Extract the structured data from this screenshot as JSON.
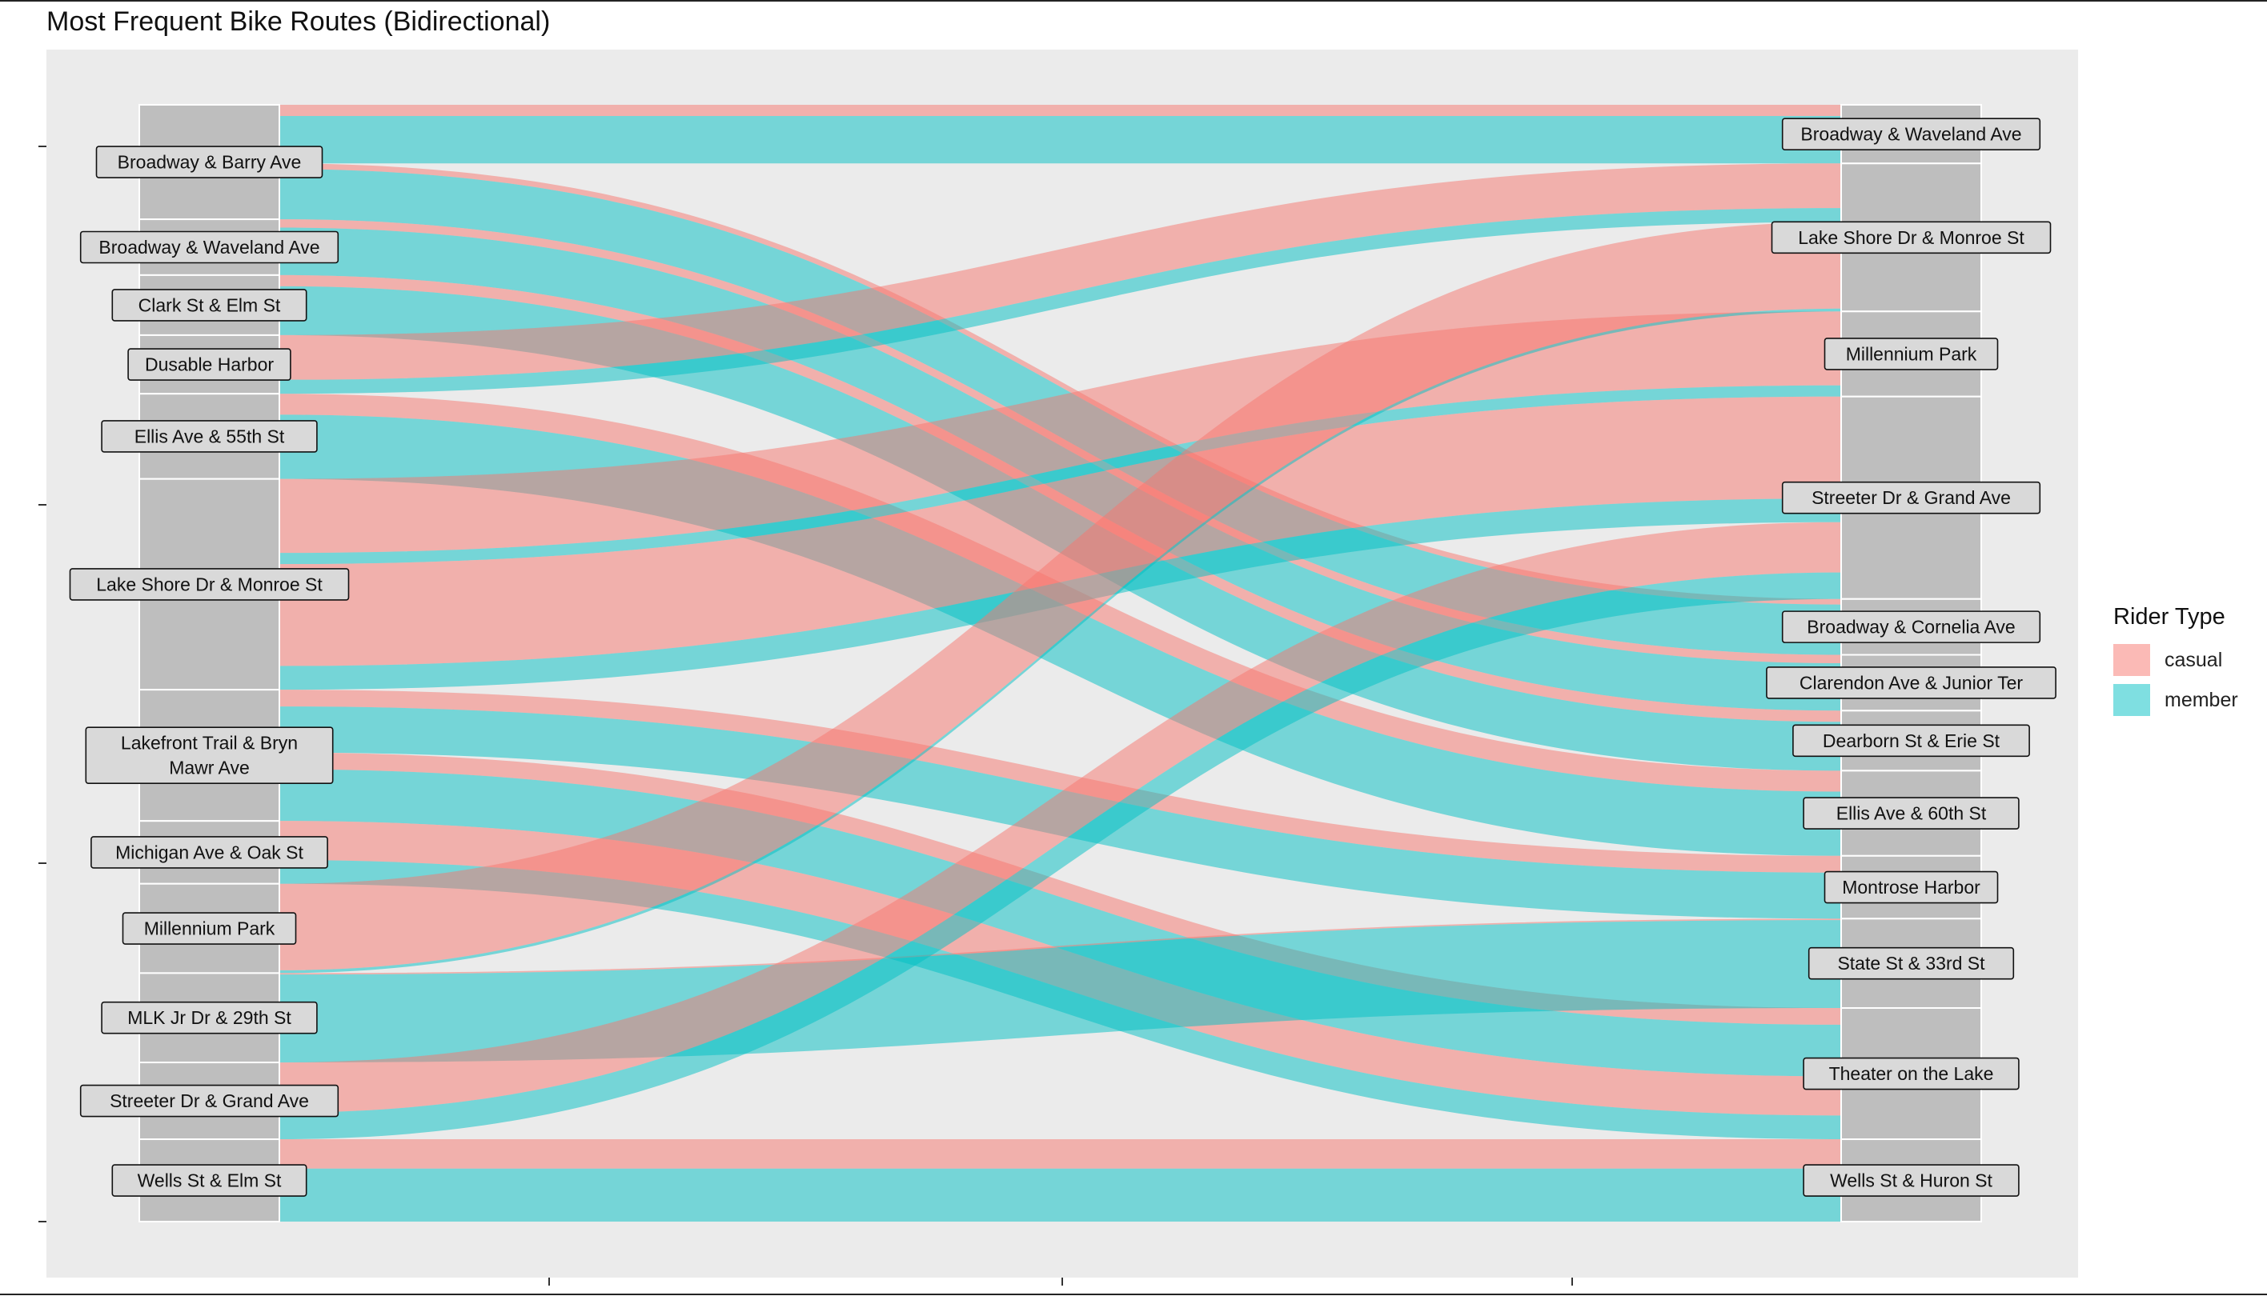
{
  "chart_data": {
    "type": "alluvial",
    "title": "Most Frequent Bike Routes (Bidirectional)",
    "legend_title": "Rider Type",
    "legend_position": "right",
    "grid": false,
    "colors": {
      "casual": "#F8766D",
      "member": "#00BFC4",
      "panel": "#EBEBEB",
      "stratum": "#BEBEBE"
    },
    "categories": [
      "casual",
      "member"
    ],
    "left_stations": [
      "Broadway & Barry Ave",
      "Broadway & Waveland Ave",
      "Clark St & Elm St",
      "Dusable Harbor",
      "Ellis Ave & 55th St",
      "Lake Shore Dr & Monroe St",
      "Lakefront Trail & Bryn Mawr Ave",
      "Michigan Ave & Oak St",
      "Millennium Park",
      "MLK Jr Dr & 29th St",
      "Streeter Dr & Grand Ave",
      "Wells St & Elm St"
    ],
    "right_stations": [
      "Broadway & Waveland Ave",
      "Lake Shore Dr & Monroe St",
      "Millennium Park",
      "Streeter Dr & Grand Ave",
      "Broadway & Cornelia Ave",
      "Clarendon Ave & Junior Ter",
      "Dearborn St & Erie St",
      "Ellis Ave & 60th St",
      "Montrose Harbor",
      "State St & 33rd St",
      "Theater on the Lake",
      "Wells St & Huron St"
    ],
    "flows": [
      {
        "from": "Broadway & Barry Ave",
        "to": "Broadway & Waveland Ave",
        "type": "casual",
        "value": 8
      },
      {
        "from": "Broadway & Barry Ave",
        "to": "Broadway & Waveland Ave",
        "type": "member",
        "value": 34
      },
      {
        "from": "Broadway & Barry Ave",
        "to": "Broadway & Cornelia Ave",
        "type": "casual",
        "value": 4
      },
      {
        "from": "Broadway & Barry Ave",
        "to": "Broadway & Cornelia Ave",
        "type": "member",
        "value": 36
      },
      {
        "from": "Broadway & Waveland Ave",
        "to": "Clarendon Ave & Junior Ter",
        "type": "casual",
        "value": 6
      },
      {
        "from": "Broadway & Waveland Ave",
        "to": "Clarendon Ave & Junior Ter",
        "type": "member",
        "value": 34
      },
      {
        "from": "Clark St & Elm St",
        "to": "Dearborn St & Erie St",
        "type": "casual",
        "value": 8
      },
      {
        "from": "Clark St & Elm St",
        "to": "Dearborn St & Erie St",
        "type": "member",
        "value": 35
      },
      {
        "from": "Dusable Harbor",
        "to": "Lake Shore Dr & Monroe St",
        "type": "casual",
        "value": 32
      },
      {
        "from": "Dusable Harbor",
        "to": "Lake Shore Dr & Monroe St",
        "type": "member",
        "value": 10
      },
      {
        "from": "Ellis Ave & 55th St",
        "to": "Ellis Ave & 60th St",
        "type": "casual",
        "value": 15
      },
      {
        "from": "Ellis Ave & 55th St",
        "to": "Ellis Ave & 60th St",
        "type": "member",
        "value": 46
      },
      {
        "from": "Lake Shore Dr & Monroe St",
        "to": "Millennium Park",
        "type": "casual",
        "value": 53
      },
      {
        "from": "Lake Shore Dr & Monroe St",
        "to": "Millennium Park",
        "type": "member",
        "value": 8
      },
      {
        "from": "Lake Shore Dr & Monroe St",
        "to": "Streeter Dr & Grand Ave",
        "type": "casual",
        "value": 73
      },
      {
        "from": "Lake Shore Dr & Monroe St",
        "to": "Streeter Dr & Grand Ave",
        "type": "member",
        "value": 17
      },
      {
        "from": "Lakefront Trail & Bryn Mawr Ave",
        "to": "Montrose Harbor",
        "type": "casual",
        "value": 12
      },
      {
        "from": "Lakefront Trail & Bryn Mawr Ave",
        "to": "Montrose Harbor",
        "type": "member",
        "value": 33
      },
      {
        "from": "Lakefront Trail & Bryn Mawr Ave",
        "to": "Theater on the Lake",
        "type": "casual",
        "value": 12
      },
      {
        "from": "Lakefront Trail & Bryn Mawr Ave",
        "to": "Theater on the Lake",
        "type": "member",
        "value": 37
      },
      {
        "from": "Michigan Ave & Oak St",
        "to": "Theater on the Lake",
        "type": "casual",
        "value": 28
      },
      {
        "from": "Michigan Ave & Oak St",
        "to": "Theater on the Lake",
        "type": "member",
        "value": 17
      },
      {
        "from": "Millennium Park",
        "to": "Lake Shore Dr & Monroe St",
        "type": "casual",
        "value": 62
      },
      {
        "from": "Millennium Park",
        "to": "Lake Shore Dr & Monroe St",
        "type": "member",
        "value": 2
      },
      {
        "from": "MLK Jr Dr & 29th St",
        "to": "State St & 33rd St",
        "type": "casual",
        "value": 1
      },
      {
        "from": "MLK Jr Dr & 29th St",
        "to": "State St & 33rd St",
        "type": "member",
        "value": 63
      },
      {
        "from": "Streeter Dr & Grand Ave",
        "to": "Streeter Dr & Grand Ave",
        "type": "casual",
        "value": 36
      },
      {
        "from": "Streeter Dr & Grand Ave",
        "to": "Streeter Dr & Grand Ave",
        "type": "member",
        "value": 19
      },
      {
        "from": "Wells St & Elm St",
        "to": "Wells St & Huron St",
        "type": "casual",
        "value": 21
      },
      {
        "from": "Wells St & Elm St",
        "to": "Wells St & Huron St",
        "type": "member",
        "value": 38
      }
    ]
  }
}
